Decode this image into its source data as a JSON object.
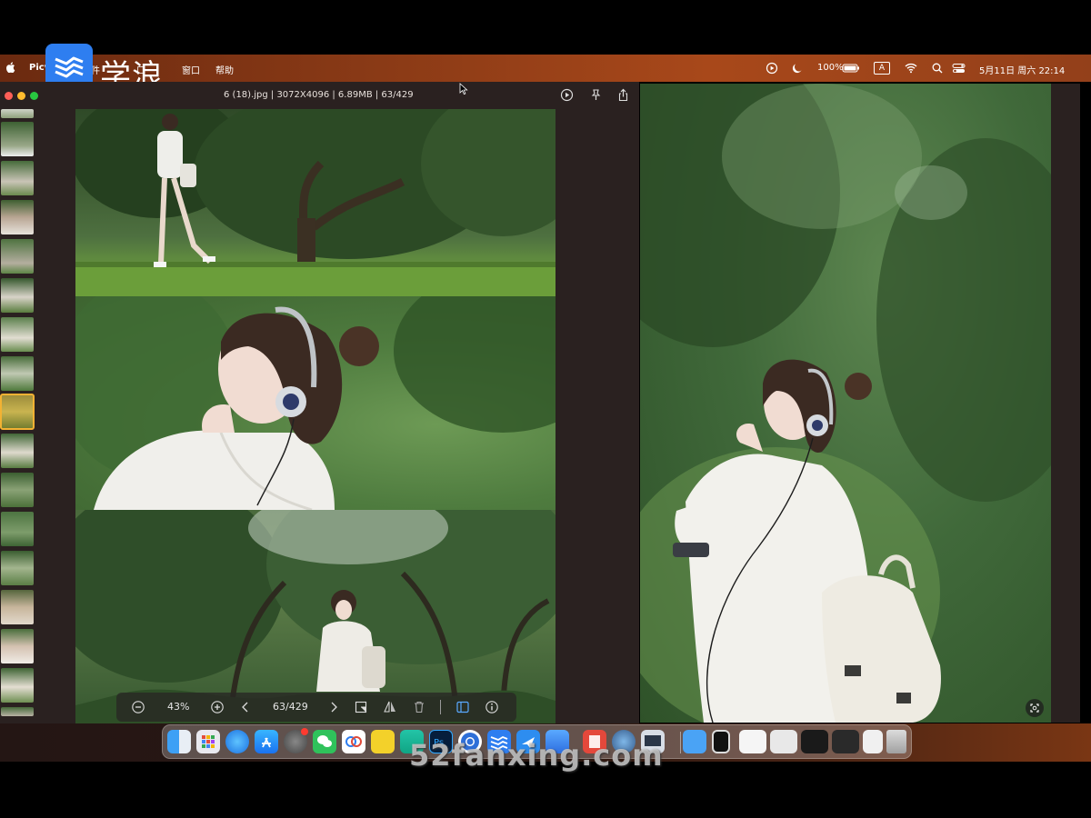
{
  "menubar": {
    "app_name": "Picvie",
    "menu_partial": "件",
    "menu_view": "口",
    "menu_window": "窗口",
    "menu_help": "帮助",
    "logo_text": "学浪",
    "battery": "100%",
    "input_indicator": "A",
    "datetime": "5月11日 周六  22:14"
  },
  "window": {
    "title": "6 (18).jpg | 3072X4096 | 6.89MB | 63/429"
  },
  "toolbar": {
    "zoom": "43%",
    "page": "63/429"
  },
  "thumbnails": {
    "count": 16,
    "selected_index": 7
  },
  "dock": {
    "watermark": "52fanxing.com"
  },
  "colors": {
    "menubar_start": "#6b2a10",
    "menubar_end": "#93401a",
    "selection": "#f2b233",
    "window_bg": "#2a2120"
  }
}
